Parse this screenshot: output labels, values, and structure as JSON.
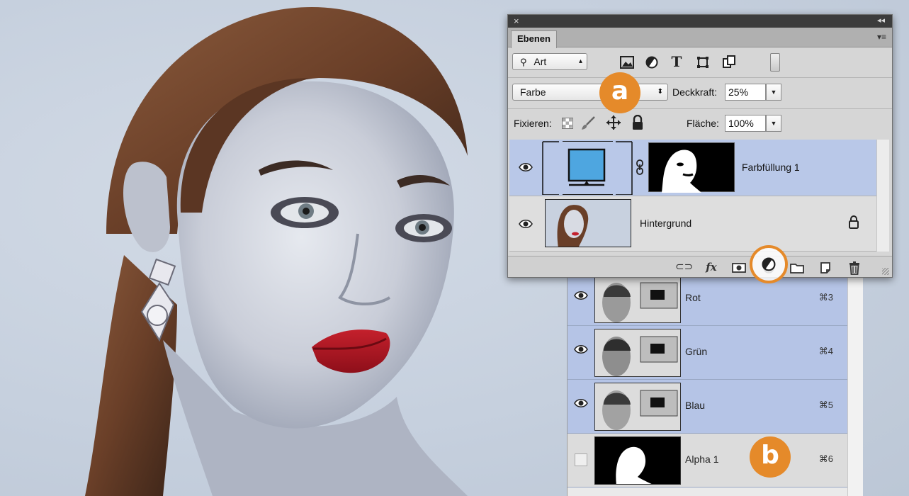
{
  "layers_panel": {
    "close_glyph": "×",
    "collapse_glyph": "◂◂",
    "tab_label": "Ebenen",
    "menu_glyph": "▾≡",
    "filter_kind": "Art",
    "blend_mode": "Farbe",
    "opacity_label": "Deckkraft:",
    "opacity_value": "25%",
    "lock_label": "Fixieren:",
    "fill_label": "Fläche:",
    "fill_value": "100%",
    "layers": [
      {
        "name": "Farbfüllung 1",
        "selected": true,
        "type": "fill-layer-with-mask"
      },
      {
        "name": "Hintergrund",
        "selected": false,
        "type": "background-locked"
      }
    ],
    "footer_fx": "fx"
  },
  "channels_panel": {
    "channels": [
      {
        "name": "Rot",
        "shortcut": "⌘3",
        "visible": true
      },
      {
        "name": "Grün",
        "shortcut": "⌘4",
        "visible": true
      },
      {
        "name": "Blau",
        "shortcut": "⌘5",
        "visible": true
      },
      {
        "name": "Alpha 1",
        "shortcut": "⌘6",
        "visible": false
      }
    ]
  },
  "callouts": {
    "a": "a",
    "b": "b"
  },
  "colors": {
    "accent": "#e58a2a",
    "selection": "#b9c8e8",
    "fill_swatch": "#4ea6e0"
  }
}
